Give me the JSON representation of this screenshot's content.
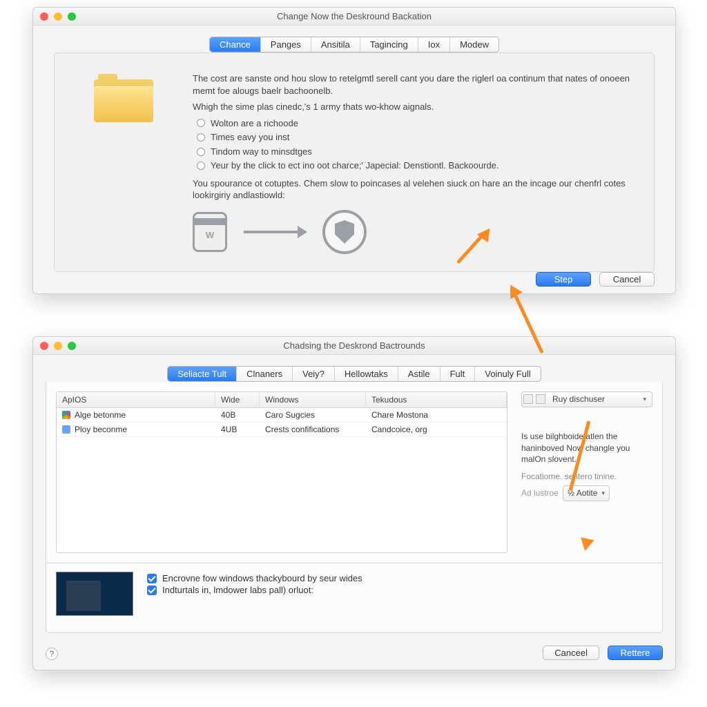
{
  "windowTop": {
    "title": "Change Now the Deskround Backation",
    "tabs": [
      "Chance",
      "Panges",
      "Ansitila",
      "Tagincing",
      "Iox",
      "Modew"
    ],
    "activeTab": 0,
    "para1": "The cost are sanste ond hou slow to retelgmtl serell cant you dare the riglerl oa continum that nates of onoeen memt foe alougs baelr bachoonelb.",
    "para2": "Whigh the sime plas cinedc,'s 1 army thats wo-khow aignals.",
    "radios": [
      "Wolton are a richoode",
      "Times eavy you inst",
      "Tindom way to minsdtges",
      "Yeur by the click to ect ino oot charce;' Japecial: Denstiontl. Backoourde."
    ],
    "para3": "You spourance ot cotuptes. Chem slow to poincases al velehen siuck on hare an the incage our chenfrl cotes lookirgiriy andlastiowld:",
    "buttons": {
      "primary": "Step",
      "cancel": "Cancel"
    }
  },
  "windowBot": {
    "title": "Chadsing the Deskrond Bactrounds",
    "tabs": [
      "Seliacte Tult",
      "Clnaners",
      "Veiy?",
      "Hellowtaks",
      "Astile",
      "Fult",
      "Voinuly Full"
    ],
    "activeTab": 0,
    "columns": [
      "ApIOS",
      "Wide",
      "Windows",
      "Tekudous"
    ],
    "rows": [
      {
        "name": "Alge betonme",
        "wide": "40B",
        "windows": "Caro Sugcies",
        "tek": "Chare Mostona"
      },
      {
        "name": "Ploy beconme",
        "wide": "4UB",
        "windows": "Crests confifications",
        "tek": "Candcoice, org"
      }
    ],
    "side": {
      "selector": "Ruy dischuser",
      "para": "Is use bilghboide atlen the haninboved Now changle you malOn slovent.",
      "note": "Focatiome. sentero tinine.",
      "label": "Ad lustroe",
      "small": "½ Aotite"
    },
    "checks": [
      "Encrovne fow windows thackybourd by seur wides",
      "Indturtals in, lmdower labs pall) orluot:"
    ],
    "buttons": {
      "cancel": "Canceel",
      "primary": "Rettere"
    }
  }
}
